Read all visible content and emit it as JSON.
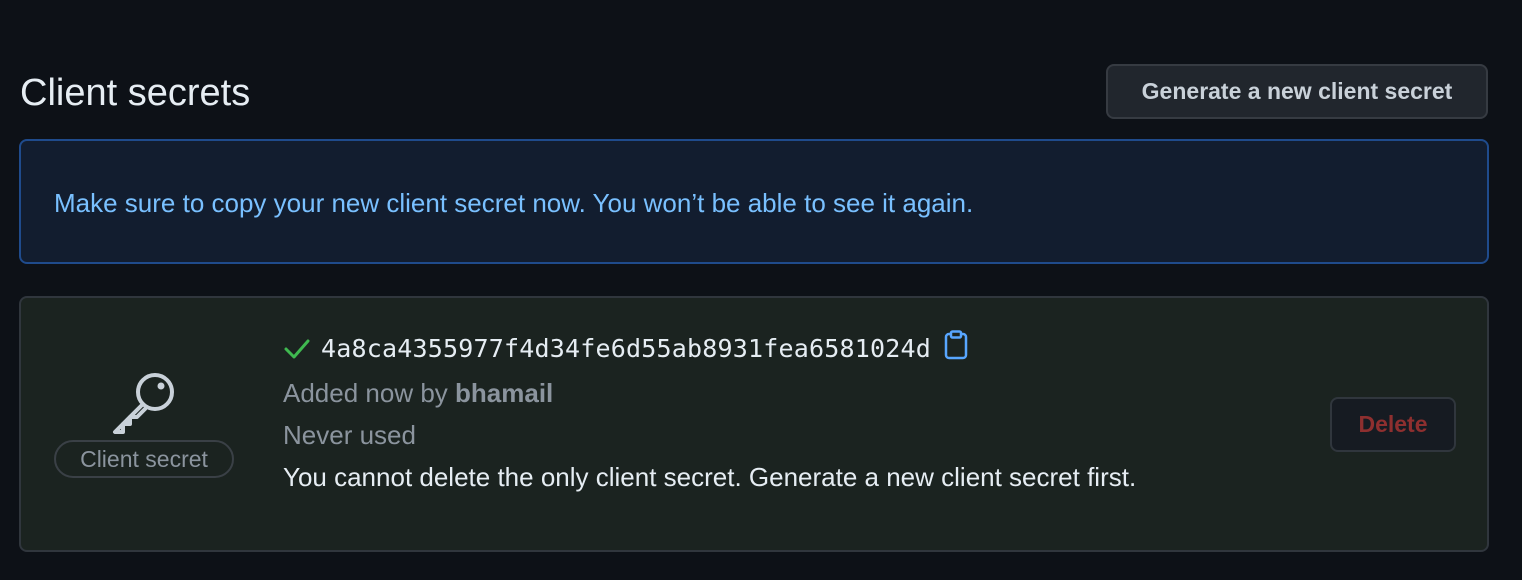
{
  "header": {
    "title": "Client secrets",
    "generate_label": "Generate a new client secret"
  },
  "flash": {
    "message": "Make sure to copy your new client secret now. You won’t be able to see it again."
  },
  "secret": {
    "label": "Client secret",
    "value": "4a8ca4355977f4d34fe6d55ab8931fea6581024d",
    "added_prefix": "Added now by",
    "added_by": "bhamail",
    "usage": "Never used",
    "delete_note": "You cannot delete the only client secret. Generate a new client secret first.",
    "delete_label": "Delete"
  },
  "icons": {
    "key": "key-icon",
    "check": "check-icon",
    "copy": "copy-icon"
  },
  "colors": {
    "background": "#0d1117",
    "flash_text": "#79c0ff",
    "check": "#3fb950",
    "danger": "#8e2f2f"
  }
}
